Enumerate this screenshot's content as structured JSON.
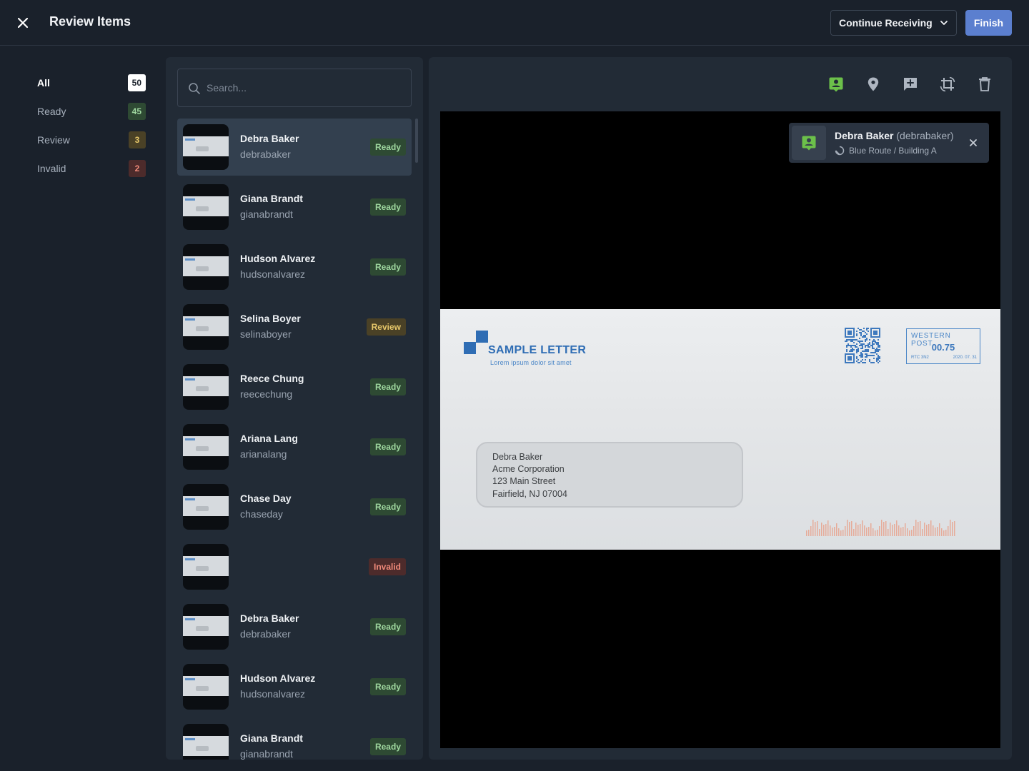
{
  "header": {
    "title": "Review Items",
    "continue_label": "Continue Receiving",
    "finish_label": "Finish"
  },
  "filters": [
    {
      "label": "All",
      "count": "50",
      "active": true,
      "bg": "#ffffff",
      "fg": "#1a212b"
    },
    {
      "label": "Ready",
      "count": "45",
      "active": false,
      "bg": "#2e4a33",
      "fg": "#9fd79f"
    },
    {
      "label": "Review",
      "count": "3",
      "active": false,
      "bg": "#4a4126",
      "fg": "#e6c76a"
    },
    {
      "label": "Invalid",
      "count": "2",
      "active": false,
      "bg": "#4d2b2b",
      "fg": "#f08a7a"
    }
  ],
  "search": {
    "placeholder": "Search..."
  },
  "status_styles": {
    "Ready": {
      "bg": "#2e4a33",
      "fg": "#9fd79f"
    },
    "Review": {
      "bg": "#4a4126",
      "fg": "#e6c76a"
    },
    "Invalid": {
      "bg": "#4d2b2b",
      "fg": "#f08a7a"
    }
  },
  "items": [
    {
      "name": "Debra Baker",
      "username": "debrabaker",
      "status": "Ready",
      "selected": true
    },
    {
      "name": "Giana Brandt",
      "username": "gianabrandt",
      "status": "Ready"
    },
    {
      "name": "Hudson Alvarez",
      "username": "hudsonalvarez",
      "status": "Ready"
    },
    {
      "name": "Selina Boyer",
      "username": "selinaboyer",
      "status": "Review"
    },
    {
      "name": "Reece Chung",
      "username": "reecechung",
      "status": "Ready"
    },
    {
      "name": "Ariana Lang",
      "username": "arianalang",
      "status": "Ready"
    },
    {
      "name": "Chase Day",
      "username": "chaseday",
      "status": "Ready"
    },
    {
      "name": "",
      "username": "",
      "status": "Invalid"
    },
    {
      "name": "Debra Baker",
      "username": "debrabaker",
      "status": "Ready"
    },
    {
      "name": "Hudson Alvarez",
      "username": "hudsonalvarez",
      "status": "Ready"
    },
    {
      "name": "Giana Brandt",
      "username": "gianabrandt",
      "status": "Ready"
    }
  ],
  "toolbar": {
    "icons": [
      "assign-recipient-icon",
      "location-pin-icon",
      "add-comment-icon",
      "crop-rotate-icon",
      "delete-icon"
    ],
    "active_color": "#6cc04a",
    "icon_color": "#aeb6c1"
  },
  "recipient_card": {
    "name": "Debra Baker",
    "handle": "(debrabaker)",
    "route": "Blue Route / Building A"
  },
  "envelope": {
    "logo_title": "SAMPLE LETTER",
    "logo_subtitle": "Lorem ipsum dolor sit amet",
    "stamp_brand": "WESTERN POST",
    "stamp_amount": "00.75",
    "stamp_code": "RTC 3N2",
    "stamp_date": "2020. 07. 31",
    "address": [
      "Debra Baker",
      "Acme Corporation",
      "123 Main Street",
      "Fairfield, NJ 07004"
    ]
  }
}
